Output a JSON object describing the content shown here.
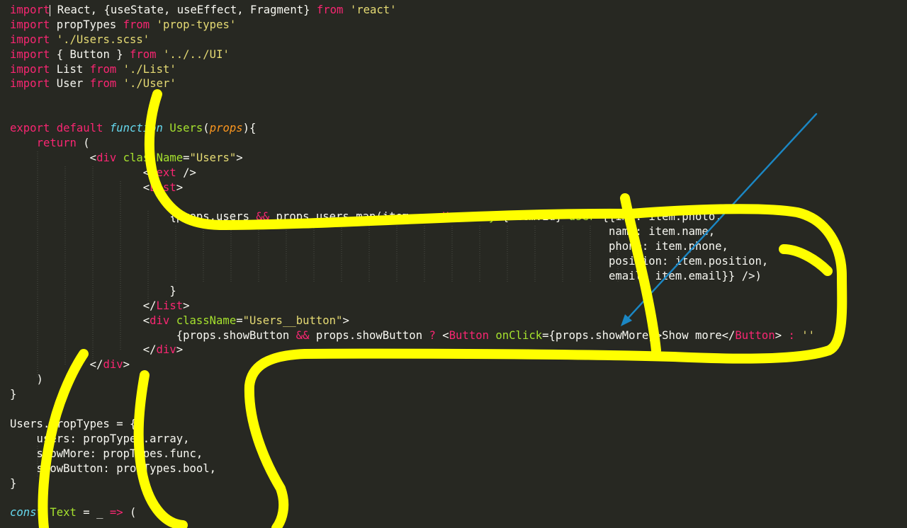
{
  "editor": {
    "theme_colors": {
      "background": "#272822",
      "keyword": "#f92672",
      "string": "#e6db74",
      "function": "#a6e22e",
      "storage": "#66d9ef",
      "parameter": "#fd971f",
      "plain": "#f8f8f2"
    },
    "lines": [
      [
        {
          "t": "import",
          "c": "kw"
        },
        {
          "t": " React, {useState, useEffect, Fragment} ",
          "c": "pl"
        },
        {
          "t": "from",
          "c": "kw"
        },
        {
          "t": " ",
          "c": "pl"
        },
        {
          "t": "'react'",
          "c": "st"
        }
      ],
      [
        {
          "t": "import",
          "c": "kw"
        },
        {
          "t": " propTypes ",
          "c": "pl"
        },
        {
          "t": "from",
          "c": "kw"
        },
        {
          "t": " ",
          "c": "pl"
        },
        {
          "t": "'prop-types'",
          "c": "st"
        }
      ],
      [
        {
          "t": "import",
          "c": "kw"
        },
        {
          "t": " ",
          "c": "pl"
        },
        {
          "t": "'./Users.scss'",
          "c": "st"
        }
      ],
      [
        {
          "t": "import",
          "c": "kw"
        },
        {
          "t": " { Button } ",
          "c": "pl"
        },
        {
          "t": "from",
          "c": "kw"
        },
        {
          "t": " ",
          "c": "pl"
        },
        {
          "t": "'../../UI'",
          "c": "st"
        }
      ],
      [
        {
          "t": "import",
          "c": "kw"
        },
        {
          "t": " List ",
          "c": "pl"
        },
        {
          "t": "from",
          "c": "kw"
        },
        {
          "t": " ",
          "c": "pl"
        },
        {
          "t": "'./List'",
          "c": "st"
        }
      ],
      [
        {
          "t": "import",
          "c": "kw"
        },
        {
          "t": " User ",
          "c": "pl"
        },
        {
          "t": "from",
          "c": "kw"
        },
        {
          "t": " ",
          "c": "pl"
        },
        {
          "t": "'./User'",
          "c": "st"
        }
      ],
      [],
      [],
      [
        {
          "t": "export",
          "c": "kw"
        },
        {
          "t": " ",
          "c": "pl"
        },
        {
          "t": "default",
          "c": "kw"
        },
        {
          "t": " ",
          "c": "pl"
        },
        {
          "t": "function",
          "c": "sk"
        },
        {
          "t": " ",
          "c": "pl"
        },
        {
          "t": "Users",
          "c": "fn"
        },
        {
          "t": "(",
          "c": "pl"
        },
        {
          "t": "props",
          "c": "pa"
        },
        {
          "t": "){",
          "c": "pl"
        }
      ],
      [
        {
          "t": "    ",
          "c": "pl"
        },
        {
          "t": "return",
          "c": "kw"
        },
        {
          "t": " (",
          "c": "pl"
        }
      ],
      [
        {
          "t": "            <",
          "c": "pl"
        },
        {
          "t": "div",
          "c": "tg"
        },
        {
          "t": " ",
          "c": "pl"
        },
        {
          "t": "className",
          "c": "at"
        },
        {
          "t": "=",
          "c": "pl"
        },
        {
          "t": "\"Users\"",
          "c": "st"
        },
        {
          "t": ">",
          "c": "pl"
        }
      ],
      [
        {
          "t": "                    <",
          "c": "pl"
        },
        {
          "t": "Text",
          "c": "tg"
        },
        {
          "t": " />",
          "c": "pl"
        }
      ],
      [
        {
          "t": "                    <",
          "c": "pl"
        },
        {
          "t": "List",
          "c": "tg"
        },
        {
          "t": ">",
          "c": "pl"
        }
      ],
      [],
      [
        {
          "t": "                        {props.users ",
          "c": "pl"
        },
        {
          "t": "&&",
          "c": "kw"
        },
        {
          "t": " props.users.map(item => <",
          "c": "pl"
        },
        {
          "t": "User",
          "c": "tg"
        },
        {
          "t": " ",
          "c": "pl"
        },
        {
          "t": "key",
          "c": "at"
        },
        {
          "t": "={item.id} ",
          "c": "pl"
        },
        {
          "t": "user",
          "c": "at"
        },
        {
          "t": "={{img: item.photo,",
          "c": "pl"
        }
      ],
      [
        {
          "t": "                                                                                          name: item.name,",
          "c": "pl"
        }
      ],
      [
        {
          "t": "                                                                                          phone: item.phone,",
          "c": "pl"
        }
      ],
      [
        {
          "t": "                                                                                          position: item.position,",
          "c": "pl"
        }
      ],
      [
        {
          "t": "                                                                                          email: item.email}} />)",
          "c": "pl"
        }
      ],
      [
        {
          "t": "                        }",
          "c": "pl"
        }
      ],
      [
        {
          "t": "                    </",
          "c": "pl"
        },
        {
          "t": "List",
          "c": "tg"
        },
        {
          "t": ">",
          "c": "pl"
        }
      ],
      [
        {
          "t": "                    <",
          "c": "pl"
        },
        {
          "t": "div",
          "c": "tg"
        },
        {
          "t": " ",
          "c": "pl"
        },
        {
          "t": "className",
          "c": "at"
        },
        {
          "t": "=",
          "c": "pl"
        },
        {
          "t": "\"Users__button\"",
          "c": "st"
        },
        {
          "t": ">",
          "c": "pl"
        }
      ],
      [
        {
          "t": "                         {props.showButton ",
          "c": "pl"
        },
        {
          "t": "&&",
          "c": "kw"
        },
        {
          "t": " props.showButton ",
          "c": "pl"
        },
        {
          "t": "?",
          "c": "kw"
        },
        {
          "t": " <",
          "c": "pl"
        },
        {
          "t": "Button",
          "c": "tg"
        },
        {
          "t": " ",
          "c": "pl"
        },
        {
          "t": "onClick",
          "c": "at"
        },
        {
          "t": "={props.showMore}>Show more</",
          "c": "pl"
        },
        {
          "t": "Button",
          "c": "tg"
        },
        {
          "t": "> ",
          "c": "pl"
        },
        {
          "t": ":",
          "c": "kw"
        },
        {
          "t": " ''",
          "c": "st"
        }
      ],
      [
        {
          "t": "                    </",
          "c": "pl"
        },
        {
          "t": "div",
          "c": "tg"
        },
        {
          "t": ">",
          "c": "pl"
        }
      ],
      [
        {
          "t": "            </",
          "c": "pl"
        },
        {
          "t": "div",
          "c": "tg"
        },
        {
          "t": ">",
          "c": "pl"
        }
      ],
      [
        {
          "t": "    )",
          "c": "pl"
        }
      ],
      [
        {
          "t": "}",
          "c": "pl"
        }
      ],
      [],
      [
        {
          "t": "Users.propTypes = {",
          "c": "pl"
        }
      ],
      [
        {
          "t": "    users: propTypes.array,",
          "c": "pl"
        }
      ],
      [
        {
          "t": "    showMore: propTypes.func,",
          "c": "pl"
        }
      ],
      [
        {
          "t": "    showButton: propTypes.bool,",
          "c": "pl"
        }
      ],
      [
        {
          "t": "}",
          "c": "pl"
        }
      ],
      [],
      [
        {
          "t": "const",
          "c": "sk"
        },
        {
          "t": " ",
          "c": "pl"
        },
        {
          "t": "Text",
          "c": "fn"
        },
        {
          "t": " = _ ",
          "c": "pl"
        },
        {
          "t": "=>",
          "c": "kw"
        },
        {
          "t": " (",
          "c": "pl"
        }
      ]
    ]
  },
  "annotations": {
    "marker_color": "#ffff00",
    "arrow_color": "#1b87c4",
    "marker_icon": "yellow-marker-drawing-icon",
    "arrow_icon": "blue-arrow-icon"
  }
}
